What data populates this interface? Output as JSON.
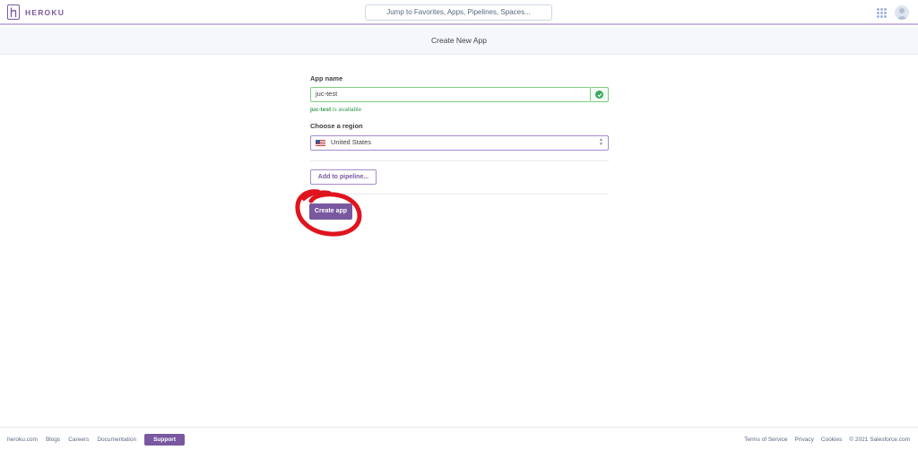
{
  "header": {
    "brand": "HEROKU",
    "search_placeholder": "Jump to Favorites, Apps, Pipelines, Spaces..."
  },
  "page": {
    "title": "Create New App"
  },
  "form": {
    "app_name_label": "App name",
    "app_name_value": "juc-test",
    "availability_name": "juc-test",
    "availability_suffix": " is available",
    "region_label": "Choose a region",
    "region_value": "United States",
    "pipeline_button": "Add to pipeline...",
    "create_button": "Create app"
  },
  "footer": {
    "left_links": [
      "heroku.com",
      "Blogs",
      "Careers",
      "Documentation"
    ],
    "support": "Support",
    "right_links": [
      "Terms of Service",
      "Privacy",
      "Cookies",
      "© 2021 Salesforce.com"
    ]
  },
  "colors": {
    "brand_purple": "#79589f",
    "success_green": "#3aa85e",
    "annotation_red": "#e0141e"
  },
  "icons": {
    "logo": "heroku-logo-icon",
    "apps": "apps-grid-icon",
    "avatar": "user-avatar-icon",
    "valid": "check-circle-icon",
    "flag": "us-flag-icon",
    "select": "updown-chevron-icon"
  }
}
